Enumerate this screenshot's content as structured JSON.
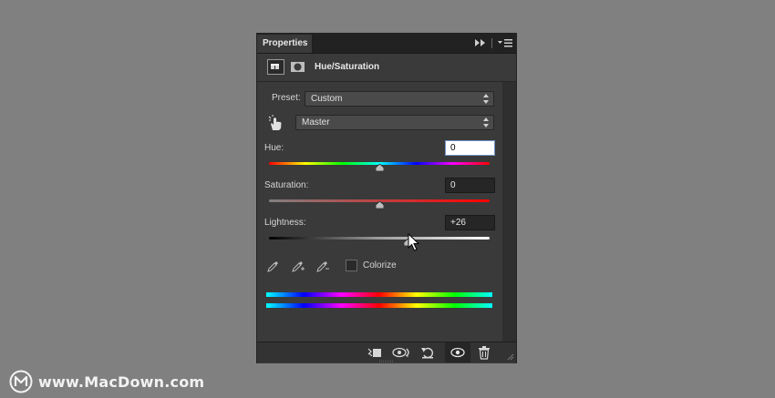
{
  "panel": {
    "tab_label": "Properties",
    "title": "Hue/Saturation"
  },
  "preset": {
    "label": "Preset:",
    "value": "Custom"
  },
  "channel": {
    "value": "Master"
  },
  "sliders": {
    "hue": {
      "label": "Hue:",
      "value": "0",
      "fraction": 0.5
    },
    "saturation": {
      "label": "Saturation:",
      "value": "0",
      "fraction": 0.5
    },
    "lightness": {
      "label": "Lightness:",
      "value": "+26",
      "fraction": 0.63
    }
  },
  "colorize": {
    "label": "Colorize",
    "checked": false
  },
  "icons": {
    "tab_tools": [
      "fast-forward-icon",
      "panel-menu-icon"
    ],
    "header": [
      "adjustment-layer-icon",
      "layer-mask-icon"
    ],
    "tools": [
      "targeted-adjust-hand-icon",
      "eyedropper-icon",
      "eyedropper-plus-icon",
      "eyedropper-minus-icon"
    ],
    "footer": [
      "clip-to-layer-icon",
      "view-previous-state-icon",
      "reset-icon",
      "visibility-eye-icon",
      "trash-icon"
    ]
  },
  "colors": {
    "panel_bg": "#3a3a3a",
    "page_bg": "#808080",
    "field_focus": "#ffffff"
  },
  "watermark": {
    "text": "www.MacDown.com"
  }
}
